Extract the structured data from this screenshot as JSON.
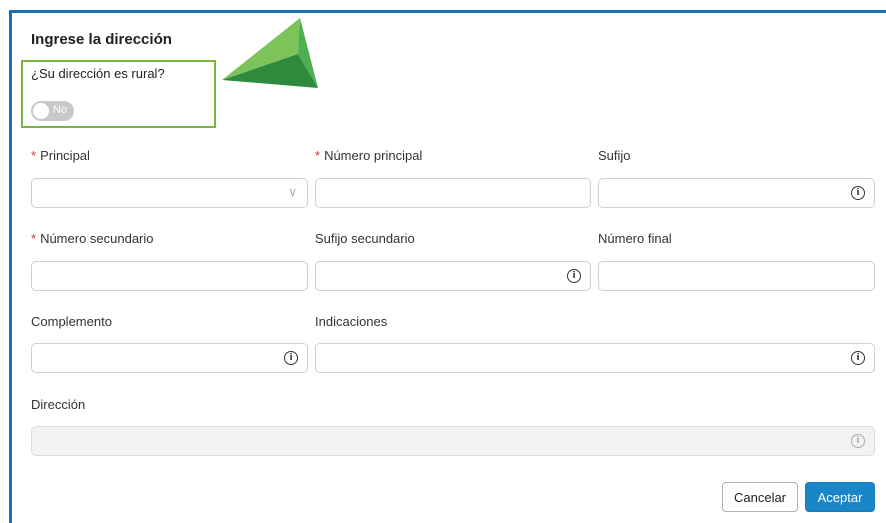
{
  "form": {
    "title": "Ingrese la dirección",
    "rural_question": "¿Su dirección es rural?",
    "rural_toggle_text": "No",
    "required_mark": "*",
    "fields": {
      "principal": {
        "label": "Principal",
        "required": true,
        "value": ""
      },
      "numero_principal": {
        "label": "Número principal",
        "required": true,
        "value": ""
      },
      "sufijo": {
        "label": "Sufijo",
        "required": false,
        "value": ""
      },
      "numero_secundario": {
        "label": "Número secundario",
        "required": true,
        "value": ""
      },
      "sufijo_secundario": {
        "label": "Sufijo secundario",
        "required": false,
        "value": ""
      },
      "numero_final": {
        "label": "Número final",
        "required": false,
        "value": ""
      },
      "complemento": {
        "label": "Complemento",
        "required": false,
        "value": ""
      },
      "indicaciones": {
        "label": "Indicaciones",
        "required": false,
        "value": ""
      },
      "direccion": {
        "label": "Dirección",
        "required": false,
        "value": "",
        "disabled": true
      }
    },
    "buttons": {
      "cancel": "Cancelar",
      "accept": "Aceptar"
    }
  },
  "colors": {
    "frame_border": "#1a6fb3",
    "highlight_box": "#7cb342",
    "pointer_arrow": "#4caf50",
    "accept_button": "#1a86c8",
    "required_mark": "#d9363e"
  },
  "icons": {
    "info": "info-icon",
    "dropdown": "chevron-down-icon",
    "pointer": "pointer-arrow-icon"
  }
}
